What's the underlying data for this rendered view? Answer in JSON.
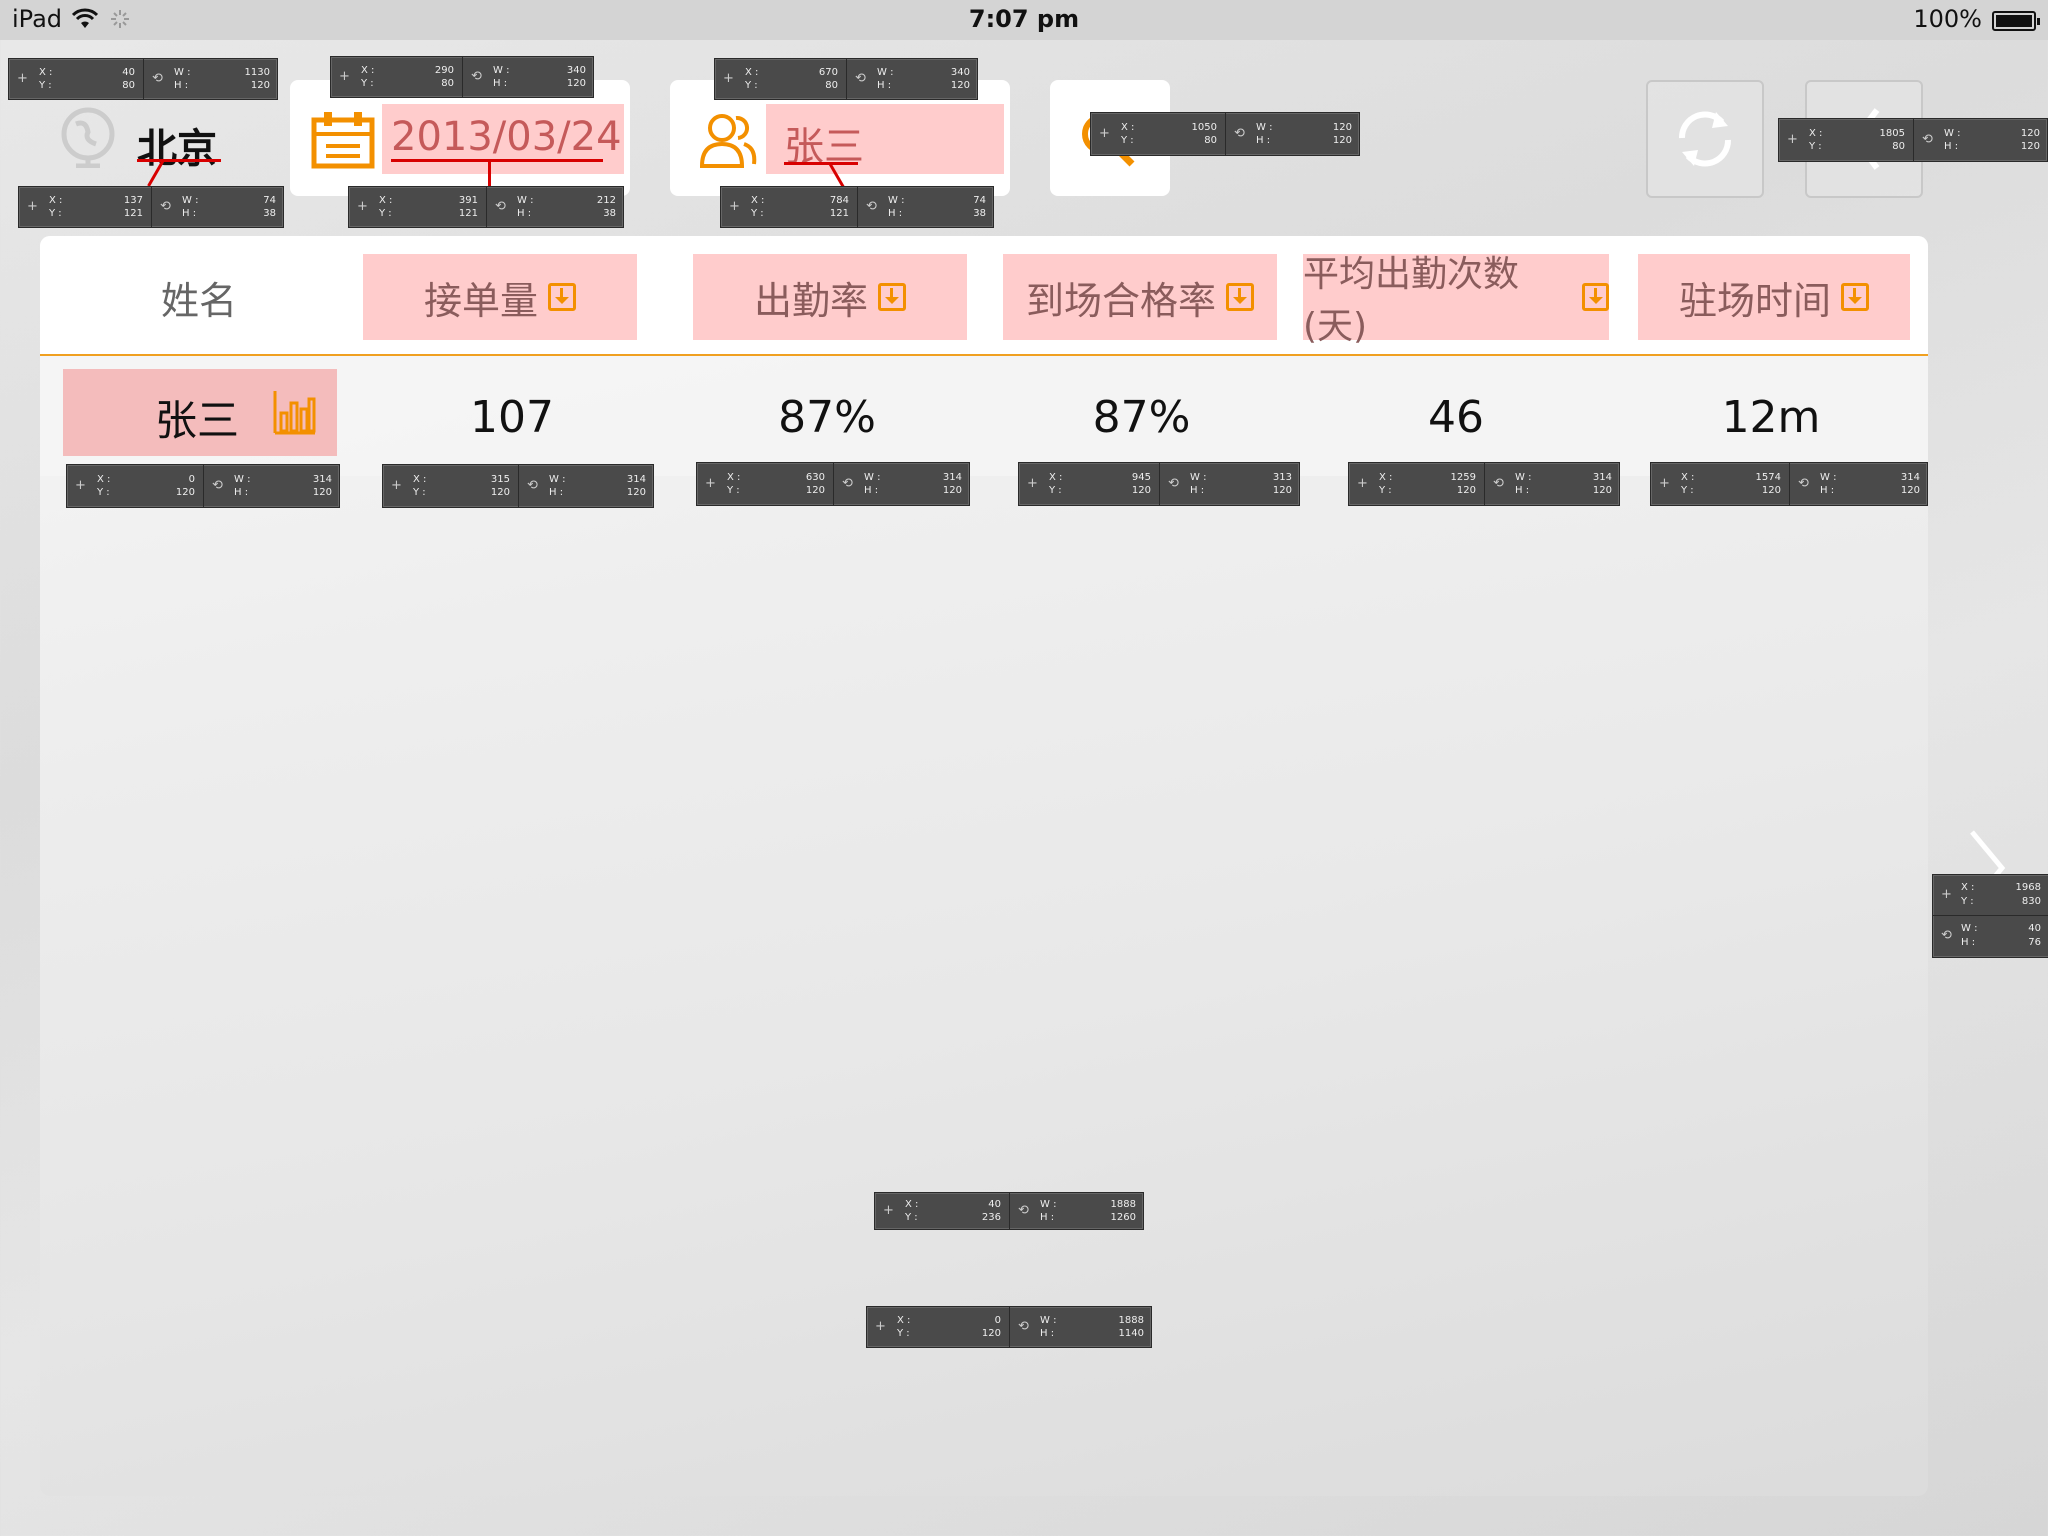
{
  "status_bar": {
    "device": "iPad",
    "time": "7:07 pm",
    "battery": "100%"
  },
  "header": {
    "city": "北京",
    "date": "2013/03/24",
    "person": "张三"
  },
  "table": {
    "columns": [
      "姓名",
      "接单量",
      "出勤率",
      "到场合格率",
      "平均出勤次数(天)",
      "驻场时间"
    ],
    "rows": [
      {
        "name": "张三",
        "orders": "107",
        "attendance": "87%",
        "pass_rate": "87%",
        "avg_attendance": "46",
        "onsite_time": "12m"
      }
    ]
  },
  "annotations": {
    "a1": {
      "x": "40",
      "y": "80",
      "w": "1130",
      "h": "120"
    },
    "a2": {
      "x": "290",
      "y": "80",
      "w": "340",
      "h": "120"
    },
    "a3": {
      "x": "670",
      "y": "80",
      "w": "340",
      "h": "120"
    },
    "a4": {
      "x": "1050",
      "y": "80",
      "w": "120",
      "h": "120"
    },
    "a5": {
      "x": "1805",
      "y": "80",
      "w": "120",
      "h": "120"
    },
    "a6": {
      "x": "137",
      "y": "121",
      "w": "74",
      "h": "38"
    },
    "a7": {
      "x": "391",
      "y": "121",
      "w": "212",
      "h": "38"
    },
    "a8": {
      "x": "784",
      "y": "121",
      "w": "74",
      "h": "38"
    },
    "c1": {
      "x": "0",
      "y": "120",
      "w": "314",
      "h": "120"
    },
    "c2": {
      "x": "315",
      "y": "120",
      "w": "314",
      "h": "120"
    },
    "c3": {
      "x": "630",
      "y": "120",
      "w": "314",
      "h": "120"
    },
    "c4": {
      "x": "945",
      "y": "120",
      "w": "313",
      "h": "120"
    },
    "c5": {
      "x": "1259",
      "y": "120",
      "w": "314",
      "h": "120"
    },
    "c6": {
      "x": "1574",
      "y": "120",
      "w": "314",
      "h": "120"
    },
    "side": {
      "x": "1968",
      "y": "830",
      "w": "40",
      "h": "76"
    },
    "panel": {
      "x": "40",
      "y": "236",
      "w": "1888",
      "h": "1260"
    },
    "list": {
      "x": "0",
      "y": "120",
      "w": "1888",
      "h": "1140"
    }
  },
  "colors": {
    "accent": "#f39000",
    "highlight": "#ffcccc",
    "marker": "#d80000"
  },
  "icons": [
    "wifi-icon",
    "activity-icon",
    "battery-icon",
    "globe-icon",
    "calendar-icon",
    "person-icon",
    "search-icon",
    "refresh-icon",
    "back-icon",
    "sort-icon",
    "bar-chart-icon",
    "chevron-right-icon"
  ]
}
